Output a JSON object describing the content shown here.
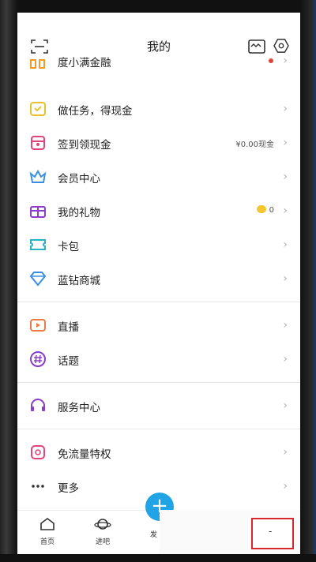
{
  "header": {
    "title": "我的",
    "icons": [
      "scan-icon",
      "wallet-icon",
      "settings-icon"
    ]
  },
  "sections": [
    {
      "items": [
        {
          "label": "度小满金融",
          "extra": "",
          "dot": true,
          "icon": "wallet-card-icon"
        },
        {
          "label": "做任务，得现金",
          "extra": "",
          "icon": "task-icon"
        },
        {
          "label": "签到领现金",
          "extra": "¥0.00现金",
          "icon": "gift-box-icon"
        },
        {
          "label": "会员中心",
          "extra": "",
          "icon": "crown-icon"
        },
        {
          "label": "我的礼物",
          "extra": "0",
          "coin": true,
          "icon": "present-icon"
        },
        {
          "label": "卡包",
          "extra": "",
          "icon": "ticket-icon"
        },
        {
          "label": "蓝钻商城",
          "extra": "",
          "icon": "diamond-icon"
        }
      ]
    },
    {
      "items": [
        {
          "label": "直播",
          "extra": "",
          "icon": "live-icon"
        },
        {
          "label": "话题",
          "extra": "",
          "icon": "hashtag-icon"
        }
      ]
    },
    {
      "items": [
        {
          "label": "服务中心",
          "extra": "",
          "icon": "headset-icon"
        }
      ]
    },
    {
      "items": [
        {
          "label": "免流量特权",
          "extra": "",
          "icon": "free-data-icon"
        },
        {
          "label": "更多",
          "extra": "",
          "icon": "more-icon"
        }
      ]
    }
  ],
  "tabbar": {
    "tabs": [
      {
        "label": "首页",
        "icon": "home-icon"
      },
      {
        "label": "进吧",
        "icon": "planet-icon"
      },
      {
        "label": "发帖",
        "icon": "plus-icon"
      }
    ],
    "fab_symbol": "+",
    "fab_label_partial": "发",
    "minus_symbol": "-"
  },
  "colors": {
    "accent": "#21a4e6",
    "red": "#e0443a",
    "gold": "#f2c531"
  }
}
